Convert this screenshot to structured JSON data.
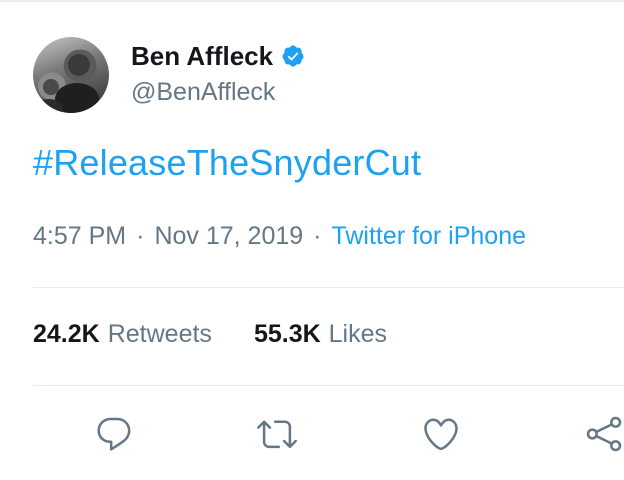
{
  "tweet": {
    "author": {
      "name": "Ben Affleck",
      "handle": "@BenAffleck",
      "verified": true
    },
    "text": "#ReleaseTheSnyderCut",
    "time": "4:57 PM",
    "separator": "·",
    "date": "Nov 17, 2019",
    "client": "Twitter for iPhone",
    "stats": {
      "retweets": {
        "count": "24.2K",
        "label": "Retweets"
      },
      "likes": {
        "count": "55.3K",
        "label": "Likes"
      }
    }
  },
  "icons": {
    "reply": "reply-icon",
    "retweet": "retweet-icon",
    "like": "heart-icon",
    "share": "share-icon",
    "verified": "verified-badge-icon"
  },
  "colors": {
    "accent": "#1da1f2",
    "text": "#14171a",
    "secondary": "#657786",
    "divider": "#e6ecf0"
  }
}
